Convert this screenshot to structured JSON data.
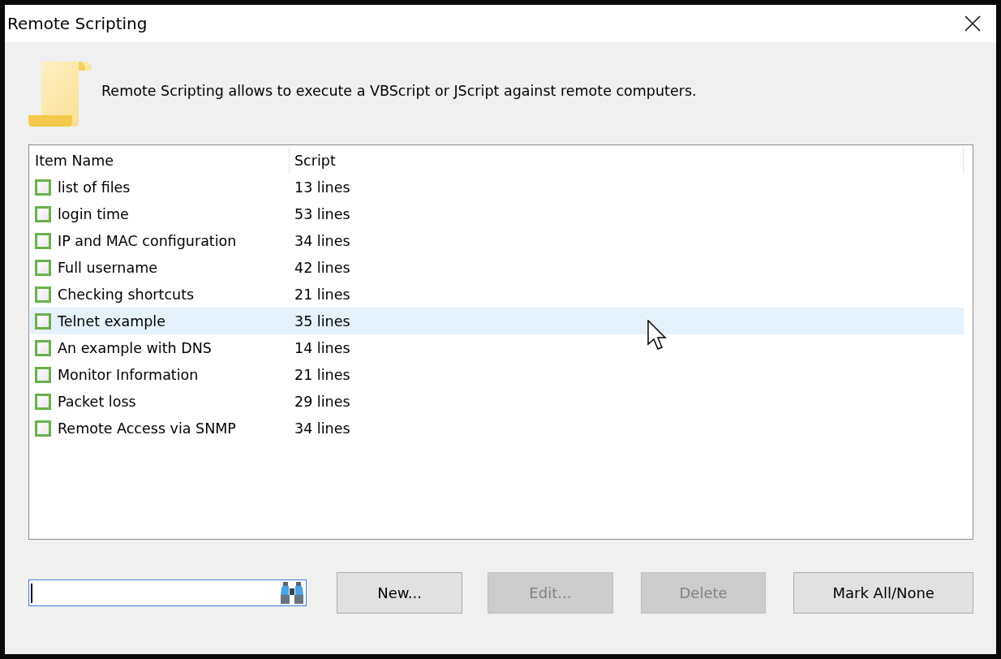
{
  "window": {
    "title": "Remote Scripting"
  },
  "description": "Remote Scripting allows to execute a VBScript or JScript against remote computers.",
  "table": {
    "columns": [
      "Item Name",
      "Script"
    ],
    "rows": [
      {
        "name": "list of files",
        "script": "13 lines",
        "checked": false,
        "selected": false
      },
      {
        "name": "login time",
        "script": "53 lines",
        "checked": false,
        "selected": false
      },
      {
        "name": "IP and MAC configuration",
        "script": "34 lines",
        "checked": false,
        "selected": false
      },
      {
        "name": "Full username",
        "script": "42 lines",
        "checked": false,
        "selected": false
      },
      {
        "name": "Checking shortcuts",
        "script": "21 lines",
        "checked": false,
        "selected": false
      },
      {
        "name": "Telnet example",
        "script": "35 lines",
        "checked": false,
        "selected": true
      },
      {
        "name": "An example with DNS",
        "script": "14 lines",
        "checked": false,
        "selected": false
      },
      {
        "name": "Monitor Information",
        "script": "21 lines",
        "checked": false,
        "selected": false
      },
      {
        "name": "Packet loss",
        "script": "29 lines",
        "checked": false,
        "selected": false
      },
      {
        "name": "Remote Access via SNMP",
        "script": "34 lines",
        "checked": false,
        "selected": false
      }
    ]
  },
  "buttons": [
    {
      "label": "New...",
      "disabled": false
    },
    {
      "label": "Edit...",
      "disabled": true
    },
    {
      "label": "Delete",
      "disabled": true
    },
    {
      "label": "Mark All/None",
      "disabled": false
    }
  ]
}
